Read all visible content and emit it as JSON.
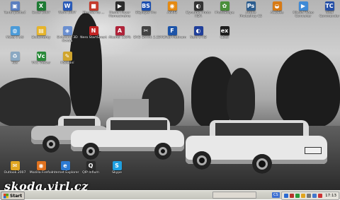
{
  "desktop": {
    "icons": [
      {
        "label": "Tento počítač",
        "color": "#5b7fbf",
        "glyph": "▣"
      },
      {
        "label": "Excel 2007",
        "color": "#1e7b34",
        "glyph": "X"
      },
      {
        "label": "Word 2007",
        "color": "#2a5bb8",
        "glyph": "W"
      },
      {
        "label": "Zkratka na ...",
        "color": "#c43b2c",
        "glyph": "■"
      },
      {
        "label": "Media Player Homecinema",
        "color": "#2b2b2b",
        "glyph": "▶"
      },
      {
        "label": "BSplayer Pro",
        "color": "#1b4fb0",
        "glyph": "BS"
      },
      {
        "label": "AIMP3",
        "color": "#e58a12",
        "glyph": "◉"
      },
      {
        "label": "Dynamic Photo HDR",
        "color": "#333333",
        "glyph": "◐"
      },
      {
        "label": "PhotoScape",
        "color": "#4a8f3a",
        "glyph": "✿"
      },
      {
        "label": "Adobe Photoshop CS",
        "color": "#2c5d8f",
        "glyph": "Ps"
      },
      {
        "label": "ACDSee",
        "color": "#d77a15",
        "glyph": "◒"
      },
      {
        "label": "Xilisoft Video Converter",
        "color": "#3f8ad6",
        "glyph": "▶"
      },
      {
        "label": "Total Commander",
        "color": "#2650a7",
        "glyph": "TC"
      },
      {
        "label": "Místa v síti",
        "color": "#4b9bd8",
        "glyph": "◍"
      },
      {
        "label": "Dokumenty",
        "color": "#e6b42a",
        "glyph": "▤"
      },
      {
        "label": "Ovladače 3D Nvidia",
        "color": "#6a8fd0",
        "glyph": "◈"
      },
      {
        "label": "Nero StartSmart",
        "color": "#c12424",
        "glyph": "N"
      },
      {
        "label": "Alcohol 120%",
        "color": "#b0243a",
        "glyph": "A"
      },
      {
        "label": "DVD Shrink 3.2",
        "color": "#424242",
        "glyph": "✂"
      },
      {
        "label": "DVDFab Platinum",
        "color": "#1d54a8",
        "glyph": "F"
      },
      {
        "label": "Nero 9 HD",
        "color": "#203f9a",
        "glyph": "◐"
      },
      {
        "label": "CDex",
        "color": "#1e1e1e",
        "glyph": "ex"
      },
      {
        "label": "Koš",
        "color": "#8aa8c2",
        "glyph": "♻"
      },
      {
        "label": "VNC Viewer",
        "color": "#2a8a3a",
        "glyph": "Vc"
      },
      {
        "label": "Poslední",
        "color": "#d0a52e",
        "glyph": "✎"
      },
      {
        "label": "Outlook 2007",
        "color": "#e0a623",
        "glyph": "✉"
      },
      {
        "label": "Mozilla Firefox",
        "color": "#e0721f",
        "glyph": "◉"
      },
      {
        "label": "Internet Explorer",
        "color": "#2d7ad1",
        "glyph": "e"
      },
      {
        "label": "QIP Infium",
        "color": "#2b2b2b",
        "glyph": "Q"
      },
      {
        "label": "Skype",
        "color": "#1fa0e0",
        "glyph": "S"
      }
    ]
  },
  "watermark": "skoda.virl.cz",
  "taskbar": {
    "start_label": "Start",
    "task_label": "",
    "lang": "CS",
    "clock": "17:13",
    "tray_colors": [
      "#2a6ad1",
      "#b8322b",
      "#2b9a3b",
      "#e1a51f",
      "#777777",
      "#4477cc",
      "#cc3333"
    ]
  }
}
